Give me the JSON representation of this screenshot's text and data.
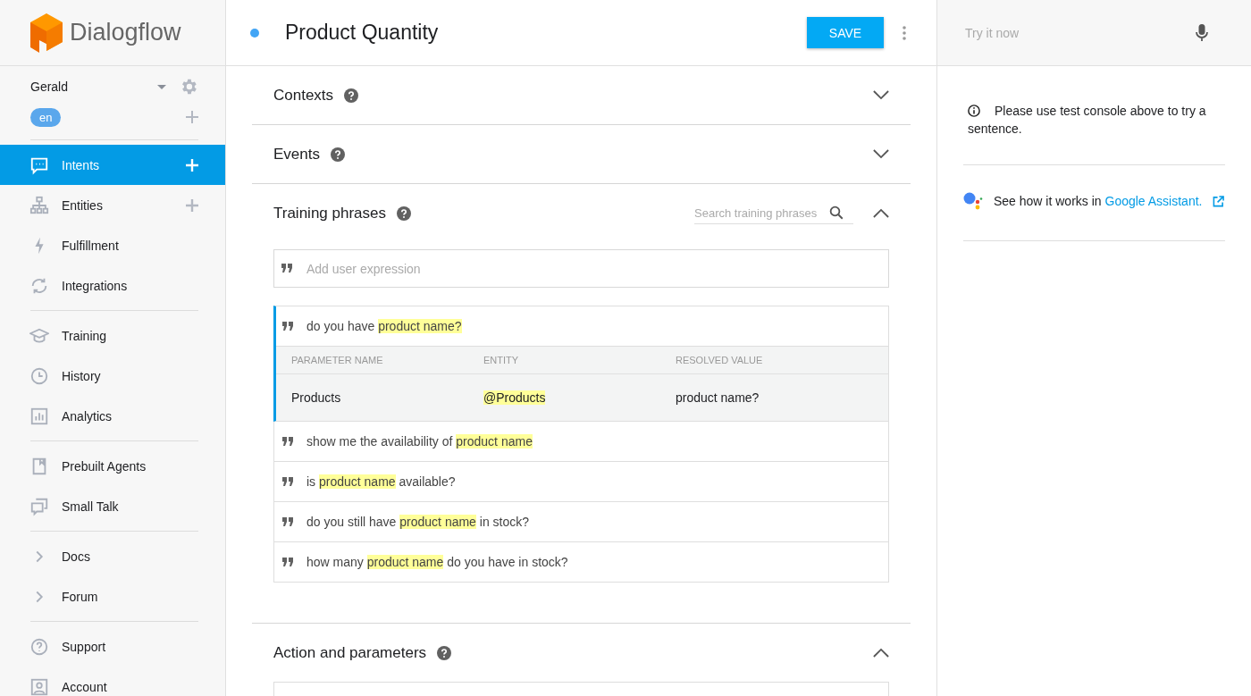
{
  "brand": {
    "name": "Dialogflow"
  },
  "agent": {
    "name": "Gerald",
    "language": "en"
  },
  "sidebar": {
    "groups": [
      {
        "items": [
          {
            "label": "Intents",
            "selected": true,
            "addable": true
          },
          {
            "label": "Entities",
            "selected": false,
            "addable": true
          },
          {
            "label": "Fulfillment",
            "selected": false,
            "addable": false
          },
          {
            "label": "Integrations",
            "selected": false,
            "addable": false
          }
        ]
      },
      {
        "items": [
          {
            "label": "Training",
            "selected": false,
            "addable": false
          },
          {
            "label": "History",
            "selected": false,
            "addable": false
          },
          {
            "label": "Analytics",
            "selected": false,
            "addable": false
          }
        ]
      },
      {
        "items": [
          {
            "label": "Prebuilt Agents",
            "selected": false,
            "addable": false
          },
          {
            "label": "Small Talk",
            "selected": false,
            "addable": false
          }
        ]
      },
      {
        "items": [
          {
            "label": "Docs",
            "selected": false,
            "addable": false
          },
          {
            "label": "Forum",
            "selected": false,
            "addable": false
          }
        ]
      },
      {
        "items": [
          {
            "label": "Support",
            "selected": false,
            "addable": false
          },
          {
            "label": "Account",
            "selected": false,
            "addable": false
          }
        ]
      }
    ]
  },
  "intent": {
    "title": "Product Quantity",
    "save_label": "SAVE"
  },
  "sections": [
    {
      "kind": "simple",
      "title": "Contexts",
      "expanded": false
    },
    {
      "kind": "simple",
      "title": "Events",
      "expanded": false
    },
    {
      "kind": "training",
      "title": "Training phrases",
      "expanded": true,
      "search_placeholder": "Search training phrases",
      "add_placeholder": "Add user expression",
      "phrases": [
        {
          "selected": true,
          "parts": [
            {
              "text": "do you have ",
              "highlight": false
            },
            {
              "text": "product name?",
              "highlight": true
            }
          ]
        },
        {
          "selected": false,
          "parts": [
            {
              "text": "show me the availability of ",
              "highlight": false
            },
            {
              "text": "product name",
              "highlight": true
            }
          ]
        },
        {
          "selected": false,
          "parts": [
            {
              "text": "is ",
              "highlight": false
            },
            {
              "text": "product name",
              "highlight": true
            },
            {
              "text": " available?",
              "highlight": false
            }
          ]
        },
        {
          "selected": false,
          "parts": [
            {
              "text": "do you still have ",
              "highlight": false
            },
            {
              "text": "product name",
              "highlight": true
            },
            {
              "text": " in stock?",
              "highlight": false
            }
          ]
        },
        {
          "selected": false,
          "parts": [
            {
              "text": "how many ",
              "highlight": false
            },
            {
              "text": "product name",
              "highlight": true
            },
            {
              "text": " do you have in stock?",
              "highlight": false
            }
          ]
        }
      ],
      "parameter_table": {
        "columns": [
          "PARAMETER NAME",
          "ENTITY",
          "RESOLVED VALUE"
        ],
        "rows": [
          {
            "name": "Products",
            "entity": "@Products",
            "resolved_value": "product name?"
          }
        ]
      }
    },
    {
      "kind": "simple",
      "title": "Action and parameters",
      "expanded": true
    }
  ],
  "test_console": {
    "placeholder": "Try it now",
    "notice": "Please use test console above to try a sentence.",
    "assistant_text": "See how it works in ",
    "assistant_link": "Google Assistant."
  }
}
